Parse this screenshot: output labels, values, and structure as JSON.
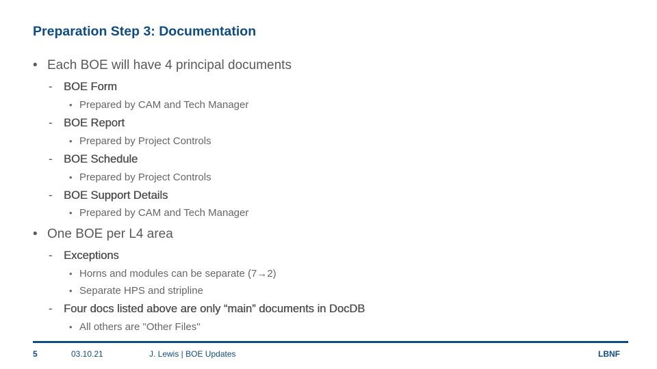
{
  "slide": {
    "title": "Preparation Step 3: Documentation",
    "bullets": [
      {
        "text": "Each BOE will have 4 principal documents",
        "sub": [
          {
            "text": "BOE Form",
            "sub": [
              "Prepared by CAM and Tech Manager"
            ]
          },
          {
            "text": "BOE Report",
            "sub": [
              "Prepared by Project Controls"
            ]
          },
          {
            "text": "BOE Schedule",
            "sub": [
              "Prepared by Project Controls"
            ]
          },
          {
            "text": "BOE Support Details",
            "sub": [
              "Prepared by CAM and Tech Manager"
            ]
          }
        ]
      },
      {
        "text": "One BOE per L4 area",
        "sub": [
          {
            "text": "Exceptions",
            "sub": [
              "Horns and modules can be separate (7→2)",
              "Separate HPS and stripline"
            ]
          },
          {
            "text": "Four docs listed above are only “main” documents in DocDB",
            "sub": [
              "All others are \"Other Files\""
            ]
          }
        ]
      }
    ],
    "markers": {
      "level1": "•",
      "level2": "-",
      "level3": "•"
    }
  },
  "footer": {
    "page_number": "5",
    "date": "03.10.21",
    "author_topic": "J. Lewis | BOE Updates",
    "brand": "LBNF"
  },
  "colors": {
    "accent": "#0f4c81",
    "body_text": "#595959"
  }
}
